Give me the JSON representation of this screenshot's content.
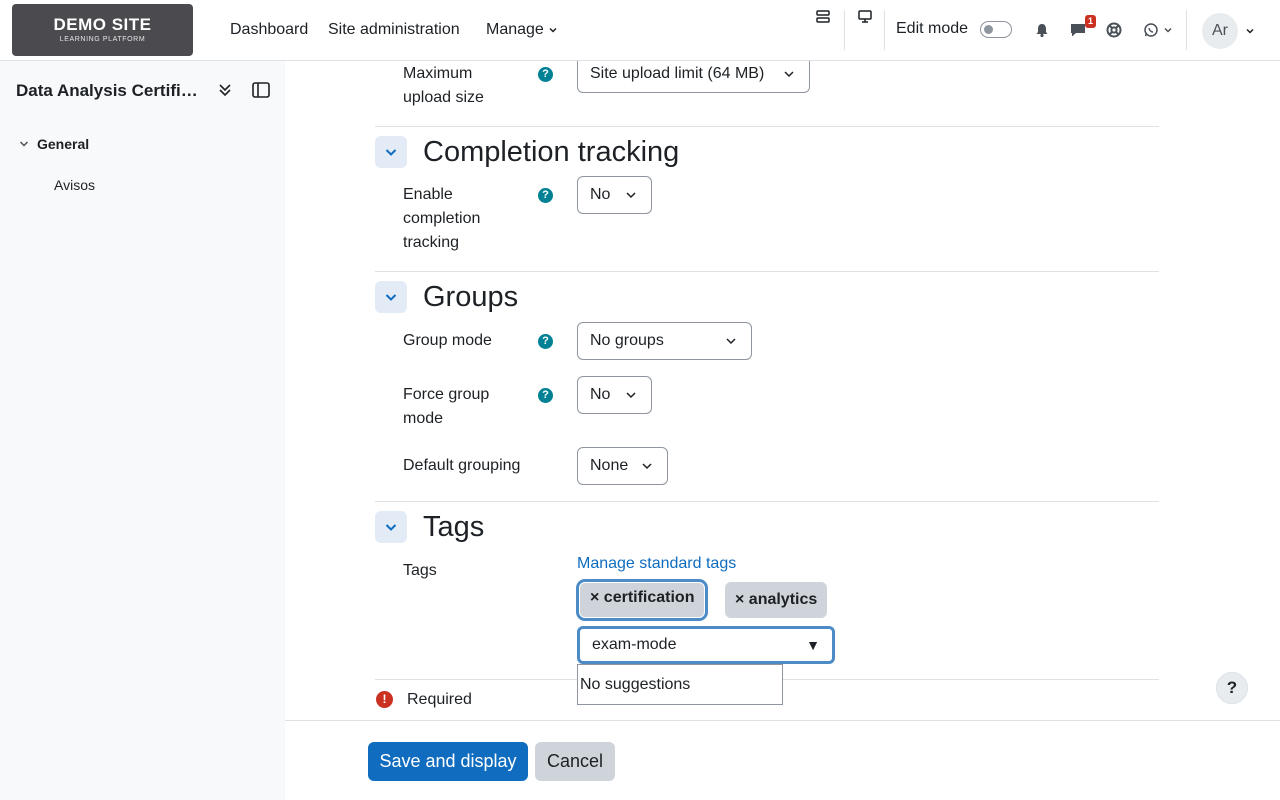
{
  "brand": {
    "name": "DEMO SITE",
    "tagline": "LEARNING PLATFORM"
  },
  "nav": {
    "links": [
      "Dashboard",
      "Site administration"
    ],
    "manage_label": "Manage",
    "edit_mode_label": "Edit mode",
    "edit_mode_on": false,
    "message_count": "1",
    "user_initials": "Ar"
  },
  "drawer": {
    "course_title": "Data Analysis Certification",
    "section_label": "General",
    "item_label": "Avisos"
  },
  "form": {
    "upload": {
      "label": "Maximum upload size",
      "value": "Site upload limit (64 MB)"
    },
    "completion": {
      "section_title": "Completion tracking",
      "enable_label": "Enable completion tracking",
      "enable_value": "No"
    },
    "groups": {
      "section_title": "Groups",
      "group_mode_label": "Group mode",
      "group_mode_value": "No groups",
      "force_label": "Force group mode",
      "force_value": "No",
      "default_grouping_label": "Default grouping",
      "default_grouping_value": "None"
    },
    "tags": {
      "section_title": "Tags",
      "field_label": "Tags",
      "manage_link": "Manage standard tags",
      "selected": [
        "× certification",
        "× analytics"
      ],
      "input_value": "exam-mode",
      "suggestion_text": "No suggestions"
    },
    "required_label": "Required"
  },
  "footer": {
    "save_label": "Save and display",
    "cancel_label": "Cancel"
  },
  "help_button": "?"
}
